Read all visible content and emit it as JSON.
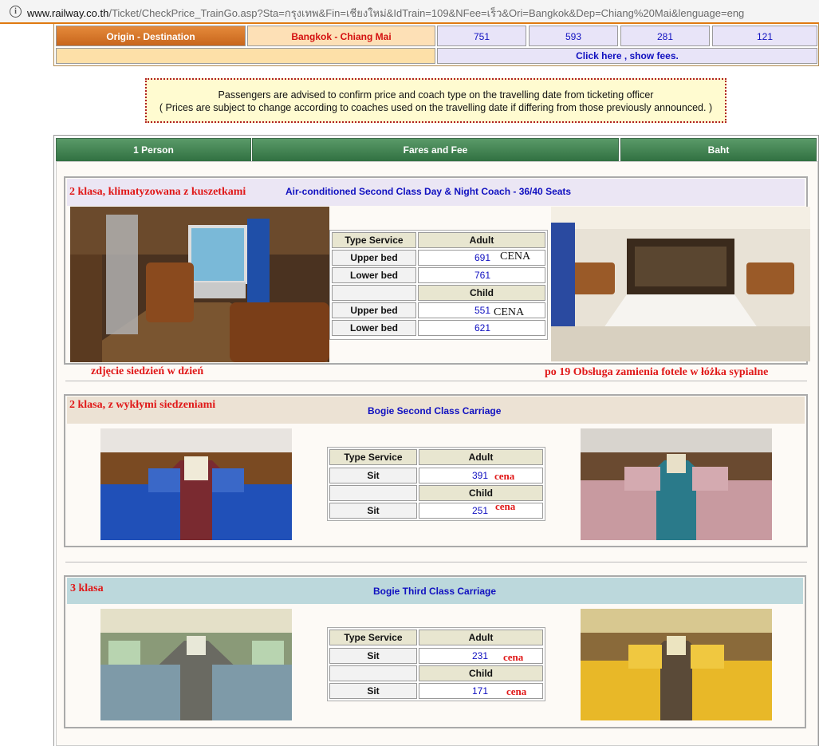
{
  "browser": {
    "url_host": "www.railway.co.th",
    "url_rest": "/Ticket/CheckPrice_TrainGo.asp?Sta=กรุงเทพ&Fin=เชียงใหม่&IdTrain=109&NFee=เร็ว&Ori=Bangkok&Dep=Chiang%20Mai&lenguage=eng"
  },
  "route": {
    "label": "Origin - Destination",
    "value": "Bangkok - Chiang Mai",
    "prices": [
      "751",
      "593",
      "281",
      "121"
    ],
    "fees_link": "Click here , show fees."
  },
  "notice": {
    "line1": "Passengers are advised to confirm price and coach type on the travelling date from ticketing officer",
    "line2": "( Prices are subject to change according to coaches used on the travelling date if differing from those previously announced. )"
  },
  "table_header": {
    "col1": "1 Person",
    "col2": "Fares and Fee",
    "col3": "Baht"
  },
  "fare_labels": {
    "type_service": "Type Service",
    "adult": "Adult",
    "child": "Child"
  },
  "sections": [
    {
      "polish_title": "2 klasa, klimatyzowana z kuszetkami",
      "coach_title": "Air-conditioned Second Class Day & Night Coach - 36/40 Seats",
      "adult_rows": [
        {
          "service": "Upper bed",
          "price": "691",
          "note": "CENA"
        },
        {
          "service": "Lower bed",
          "price": "761",
          "note": ""
        }
      ],
      "child_rows": [
        {
          "service": "Upper bed",
          "price": "551",
          "note": "CENA"
        },
        {
          "service": "Lower bed",
          "price": "621",
          "note": ""
        }
      ],
      "caption_left": "zdjęcie siedzień w dzień",
      "caption_right": "po 19 Obsługa zamienia fotele w łóżka sypialne"
    },
    {
      "polish_title": "2 klasa, z wykłymi siedzeniami",
      "coach_title": "Bogie Second Class Carriage",
      "adult_rows": [
        {
          "service": "Sit",
          "price": "391",
          "note": "cena"
        }
      ],
      "child_rows": [
        {
          "service": "Sit",
          "price": "251",
          "note": "cena"
        }
      ]
    },
    {
      "polish_title": "3 klasa",
      "coach_title": "Bogie Third Class Carriage",
      "adult_rows": [
        {
          "service": "Sit",
          "price": "231",
          "note": "cena"
        }
      ],
      "child_rows": [
        {
          "service": "Sit",
          "price": "171",
          "note": "cena"
        }
      ]
    }
  ]
}
